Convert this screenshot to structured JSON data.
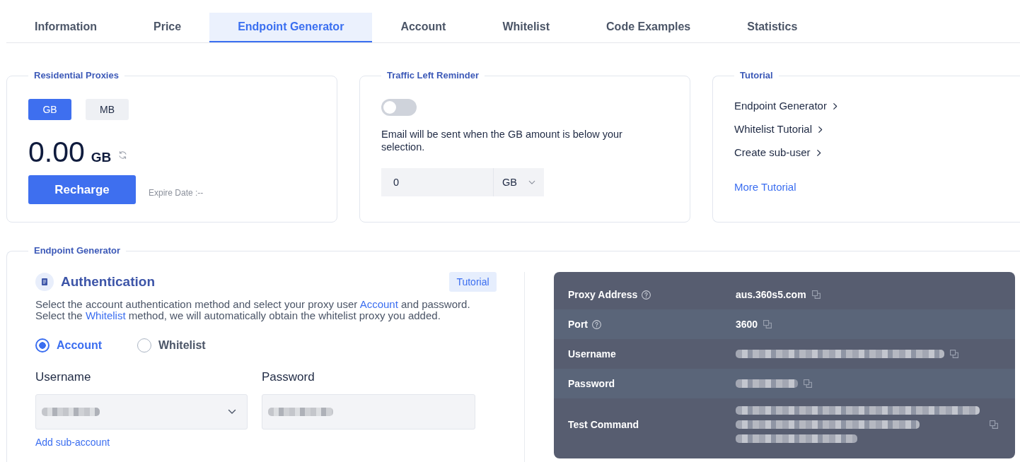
{
  "tabs": [
    {
      "label": "Information",
      "selected": false
    },
    {
      "label": "Price",
      "selected": false
    },
    {
      "label": "Endpoint Generator",
      "selected": true
    },
    {
      "label": "Account",
      "selected": false
    },
    {
      "label": "Whitelist",
      "selected": false
    },
    {
      "label": "Code Examples",
      "selected": false
    },
    {
      "label": "Statistics",
      "selected": false
    }
  ],
  "residential_proxies": {
    "title": "Residential Proxies",
    "units": [
      {
        "label": "GB",
        "selected": true
      },
      {
        "label": "MB",
        "selected": false
      }
    ],
    "balance": "0.00",
    "balance_unit": "GB",
    "recharge_button": "Recharge",
    "expire_date": "Expire Date :--"
  },
  "traffic_left_reminder": {
    "title": "Traffic Left Reminder",
    "toggle": {
      "on": false
    },
    "description": "Email will be sent when the GB amount is below your selection.",
    "threshold": {
      "value": "0",
      "unit": "GB"
    }
  },
  "tutorial": {
    "title": "Tutorial",
    "links": [
      "Endpoint Generator",
      "Whitelist Tutorial",
      "Create sub-user"
    ],
    "more_link": "More Tutorial"
  },
  "endpoint_generator": {
    "title": "Endpoint Generator",
    "authentication": {
      "heading": "Authentication",
      "tutorial_button": "Tutorial",
      "description_lines": [
        [
          {
            "kind": "text",
            "text": "Select the account authentication method and select your proxy user "
          },
          {
            "kind": "link",
            "text": "Account"
          },
          {
            "kind": "text",
            "text": " and password."
          }
        ],
        [
          {
            "kind": "text",
            "text": "Select the "
          },
          {
            "kind": "link",
            "text": "Whitelist"
          },
          {
            "kind": "text",
            "text": " method, we will automatically obtain the whitelist proxy you added."
          }
        ]
      ],
      "methods": [
        {
          "label": "Account",
          "selected": true
        },
        {
          "label": "Whitelist",
          "selected": false
        }
      ],
      "fields": [
        {
          "label": "Username",
          "kind": "select",
          "redacted": true
        },
        {
          "label": "Password",
          "kind": "input",
          "redacted": true
        }
      ],
      "add_link": "Add sub-account"
    },
    "details": {
      "rows": [
        {
          "label": "Proxy Address",
          "help": true,
          "kind": "text",
          "value": "aus.360s5.com"
        },
        {
          "label": "Port",
          "help": true,
          "kind": "text",
          "value": "3600"
        },
        {
          "label": "Username",
          "help": false,
          "kind": "secret"
        },
        {
          "label": "Password",
          "help": false,
          "kind": "secret"
        },
        {
          "label": "Test Command",
          "help": false,
          "kind": "command"
        }
      ]
    }
  }
}
